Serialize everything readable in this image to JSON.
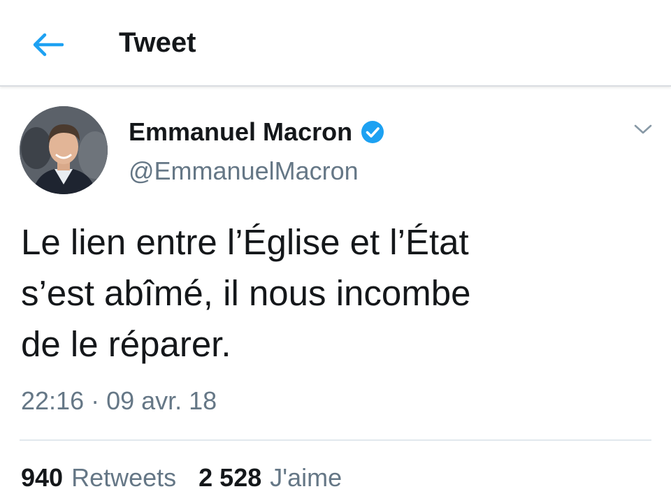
{
  "header": {
    "back_icon": "arrow-left-icon",
    "title": "Tweet"
  },
  "tweet": {
    "author": {
      "display_name": "Emmanuel Macron",
      "handle": "@EmmanuelMacron",
      "verified_icon": "verified-badge-icon"
    },
    "menu_icon": "chevron-down-icon",
    "text_lines": [
      "Le lien entre l’Église et l’État",
      "s’est abîmé, il nous incombe",
      "de le réparer."
    ],
    "timestamp": "22:16 · 09 avr. 18",
    "stats": {
      "retweets_count": "940",
      "retweets_label": "Retweets",
      "likes_count": "2 528",
      "likes_label": "J'aime"
    }
  },
  "colors": {
    "accent": "#1da1f2",
    "text_primary": "#14171a",
    "text_secondary": "#657786",
    "divider": "#e1e8ed"
  }
}
